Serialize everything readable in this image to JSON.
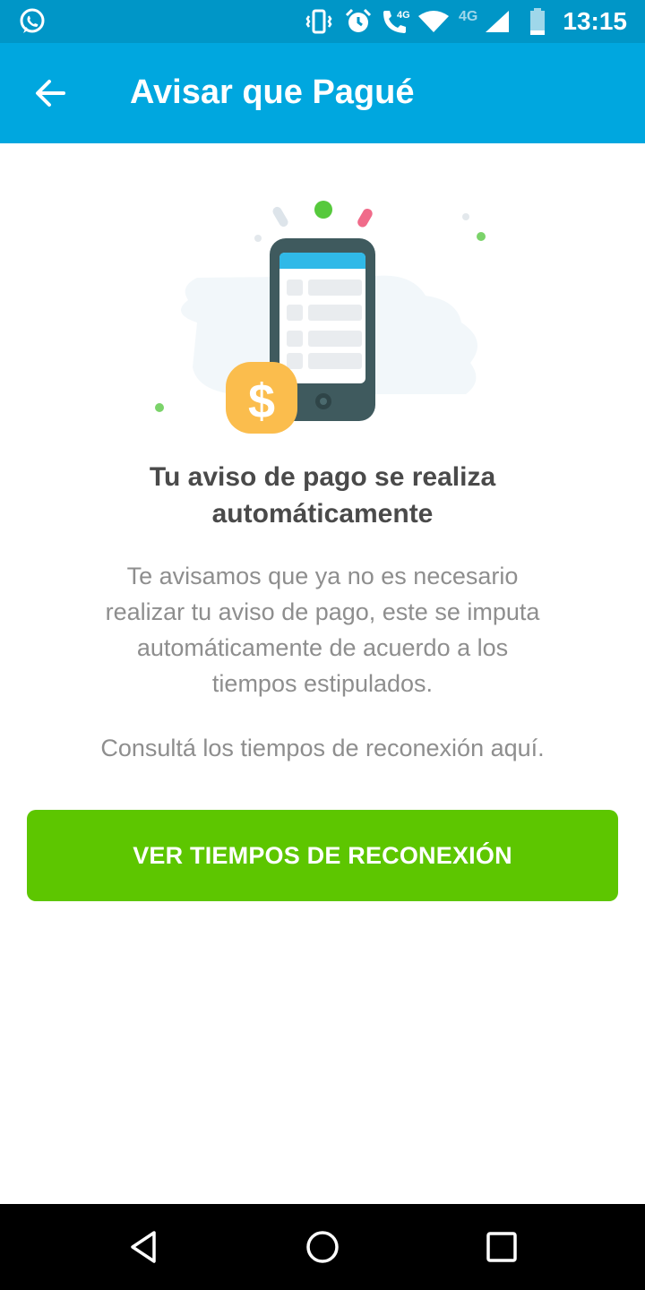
{
  "status_bar": {
    "time": "13:15",
    "network_label": "4G",
    "icons": [
      "whatsapp-icon",
      "vibrate-icon",
      "alarm-icon",
      "volte-call-icon",
      "wifi-icon",
      "signal-icon",
      "battery-icon"
    ]
  },
  "app_bar": {
    "title": "Avisar que Pagué",
    "back_icon": "arrow-left-icon"
  },
  "content": {
    "heading": "Tu aviso de pago se realiza automáticamente",
    "body": "Te avisamos que ya no es necesario realizar tu aviso de pago, este se imputa automáticamente de acuerdo a los tiempos estipulados.",
    "link_text": "Consultá los tiempos de reconexión aquí."
  },
  "cta_button": {
    "label": "VER TIEMPOS DE RECONEXIÓN"
  },
  "nav_bar": {
    "icons": [
      "back-triangle-icon",
      "home-circle-icon",
      "recents-square-icon"
    ]
  },
  "colors": {
    "status_bar": "#0096c7",
    "app_bar": "#00a7df",
    "cta": "#5dc600",
    "heading_text": "#4a4a4a",
    "body_text": "#8e8e8e"
  }
}
